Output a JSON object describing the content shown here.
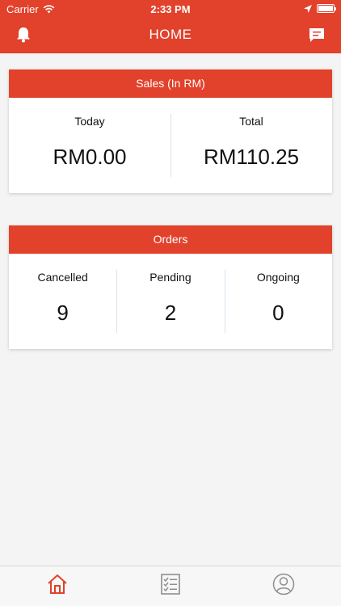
{
  "status_bar": {
    "carrier": "Carrier",
    "time": "2:33 PM"
  },
  "header": {
    "title": "HOME",
    "left_icon": "bell-icon",
    "right_icon": "chat-icon"
  },
  "sales": {
    "title": "Sales (In RM)",
    "items": [
      {
        "label": "Today",
        "value": "RM0.00"
      },
      {
        "label": "Total",
        "value": "RM110.25"
      }
    ]
  },
  "orders": {
    "title": "Orders",
    "items": [
      {
        "label": "Cancelled",
        "value": "9"
      },
      {
        "label": "Pending",
        "value": "2"
      },
      {
        "label": "Ongoing",
        "value": "0"
      }
    ]
  },
  "tabbar": {
    "tabs": [
      {
        "icon": "home-icon",
        "active": true
      },
      {
        "icon": "checklist-icon",
        "active": false
      },
      {
        "icon": "profile-icon",
        "active": false
      }
    ]
  },
  "colors": {
    "accent": "#e2412b",
    "background": "#f4f4f4",
    "tab_inactive": "#8e8e8e"
  }
}
